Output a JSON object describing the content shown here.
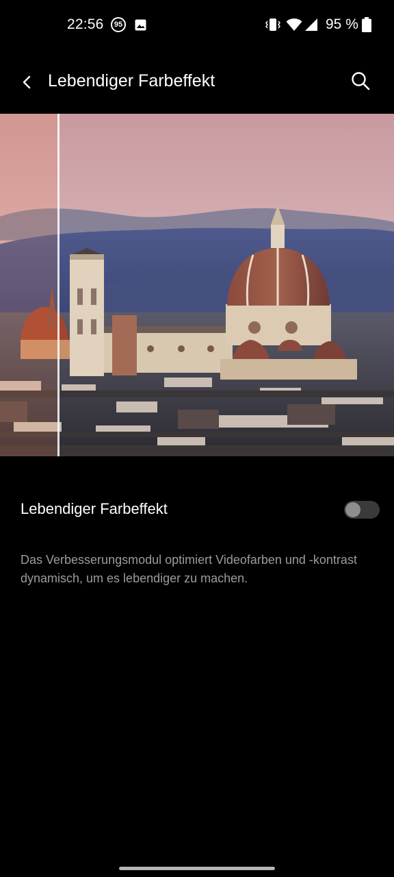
{
  "status_bar": {
    "time": "22:56",
    "notification_badge": "95",
    "battery_percent": "95 %",
    "icons": [
      "notification-count-icon",
      "image-icon",
      "vibrate-icon",
      "wifi-icon",
      "signal-icon",
      "battery-icon"
    ]
  },
  "app_bar": {
    "title": "Lebendiger Farbeffekt",
    "back_icon": "back-arrow-icon",
    "search_icon": "search-icon"
  },
  "preview": {
    "compare_split_fraction": 0.145
  },
  "setting": {
    "label": "Lebendiger Farbeffekt",
    "enabled": false
  },
  "description": "Das Verbesserungsmodul optimiert Videofarben und -kontrast dynamisch, um es lebendiger zu machen.",
  "colors": {
    "background": "#000000",
    "text_primary": "#ffffff",
    "text_secondary": "#9c9c9c",
    "toggle_track_off": "#3a3a3a",
    "toggle_thumb_off": "#8e8e8e"
  }
}
